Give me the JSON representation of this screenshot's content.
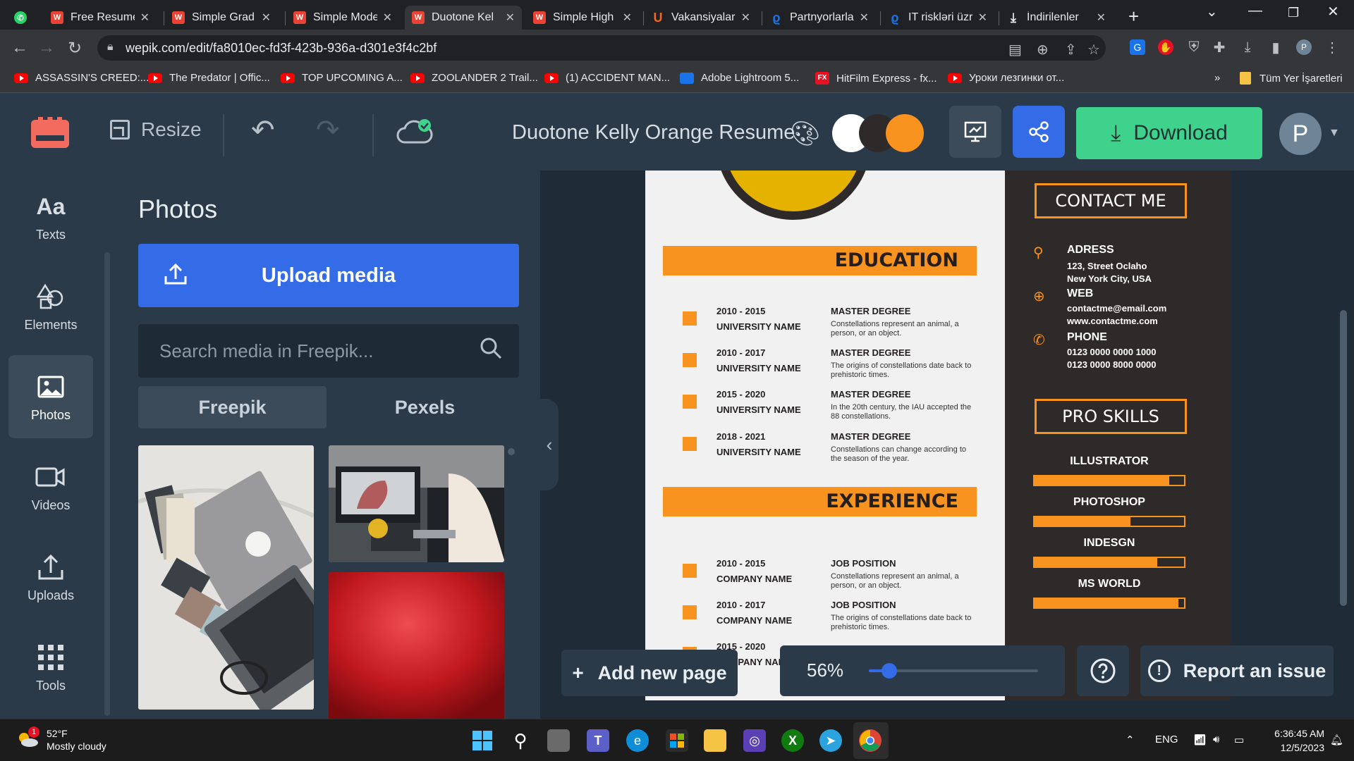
{
  "browser": {
    "tabs": [
      {
        "title": "Free Resume",
        "icon": "wepik-icon",
        "color": "#ea4335",
        "active": false
      },
      {
        "title": "Simple Grad",
        "icon": "wepik-icon",
        "color": "#ea4335",
        "active": false
      },
      {
        "title": "Simple Mode",
        "icon": "wepik-icon",
        "color": "#ea4335",
        "active": false
      },
      {
        "title": "Duotone Kel",
        "icon": "wepik-icon",
        "color": "#ea4335",
        "active": true
      },
      {
        "title": "Simple High",
        "icon": "wepik-icon",
        "color": "#ea4335",
        "active": false
      },
      {
        "title": "Vakansiyalar",
        "icon": "upwork-icon",
        "color": "#f26522",
        "active": false
      },
      {
        "title": "Partnyorlarla",
        "icon": "link-icon",
        "color": "#1a73e8",
        "active": false
      },
      {
        "title": "IT riskləri üzr",
        "icon": "link-icon",
        "color": "#1a73e8",
        "active": false
      },
      {
        "title": "İndirilenler",
        "icon": "download-icon",
        "color": "#e8eaed",
        "active": false
      }
    ],
    "url": "wepik.com/edit/fa8010ec-fd3f-423b-936a-d301e3f4c2bf",
    "bookmarks": [
      {
        "label": "ASSASSIN'S CREED:...",
        "icon": "youtube-icon"
      },
      {
        "label": "The Predator | Offic...",
        "icon": "youtube-icon"
      },
      {
        "label": "TOP UPCOMING A...",
        "icon": "youtube-icon"
      },
      {
        "label": "ZOOLANDER 2 Trail...",
        "icon": "youtube-icon"
      },
      {
        "label": "(1) ACCIDENT MAN...",
        "icon": "youtube-icon"
      },
      {
        "label": "Adobe Lightroom 5...",
        "icon": "lightroom-icon"
      },
      {
        "label": "HitFilm Express - fx...",
        "icon": "fx-icon"
      },
      {
        "label": "Уроки лезгинки от...",
        "icon": "youtube-icon"
      }
    ],
    "bookmarks_overflow": "»",
    "all_bookmarks": "Tüm Yer İşaretleri"
  },
  "header": {
    "resize_label": "Resize",
    "doc_title": "Duotone Kelly Orange Resume",
    "swatches": [
      "#ffffff",
      "#2e2a2a",
      "#f7931e"
    ],
    "download_label": "Download",
    "avatar_initial": "P",
    "colors": {
      "bar": "#2b3a48",
      "share": "#346be6",
      "download": "#3fd28d",
      "present": "#3b4b5a"
    }
  },
  "rail": [
    {
      "label": "Texts",
      "icon": "text-icon",
      "glyph": "Aa"
    },
    {
      "label": "Elements",
      "icon": "elements-icon",
      "glyph": "⬡"
    },
    {
      "label": "Photos",
      "icon": "photo-icon",
      "glyph": "▣"
    },
    {
      "label": "Videos",
      "icon": "video-icon",
      "glyph": "⏵"
    },
    {
      "label": "Uploads",
      "icon": "upload-icon",
      "glyph": "⇧"
    },
    {
      "label": "Tools",
      "icon": "grid-icon",
      "glyph": "⠿"
    }
  ],
  "panel": {
    "title": "Photos",
    "upload_label": "Upload media",
    "search_placeholder": "Search media in Freepik...",
    "tabs": [
      "Freepik",
      "Pexels"
    ]
  },
  "resume": {
    "education_title": "EDUCATION",
    "education": [
      {
        "years": "2010 - 2015",
        "org": "UNIVERSITY NAME",
        "position": "MASTER DEGREE",
        "desc": "Constellations represent an animal, a person, or an object."
      },
      {
        "years": "2010 - 2017",
        "org": "UNIVERSITY NAME",
        "position": "MASTER DEGREE",
        "desc": "The origins of constellations date back to prehistoric times."
      },
      {
        "years": "2015 - 2020",
        "org": "UNIVERSITY NAME",
        "position": "MASTER DEGREE",
        "desc": "In the 20th century, the IAU accepted the 88 constellations."
      },
      {
        "years": "2018 - 2021",
        "org": "UNIVERSITY NAME",
        "position": "MASTER DEGREE",
        "desc": "Constellations can change according to the season of the year."
      }
    ],
    "experience_title": "EXPERIENCE",
    "experience": [
      {
        "years": "2010 - 2015",
        "org": "COMPANY NAME",
        "position": "JOB POSITION",
        "desc": "Constellations represent an animal, a person, or an object."
      },
      {
        "years": "2010 - 2017",
        "org": "COMPANY NAME",
        "position": "JOB POSITION",
        "desc": "The origins of constellations date back to prehistoric times."
      },
      {
        "years": "2015 - 2020",
        "org": "COMPANY NAME",
        "position": "",
        "desc": ""
      }
    ],
    "contact_title": "CONTACT ME",
    "contact": {
      "address_label": "ADRESS",
      "address_1": "123, Street Oclaho",
      "address_2": "New York City, USA",
      "web_label": "WEB",
      "web_1": "contactme@email.com",
      "web_2": "www.contactme.com",
      "phone_label": "PHONE",
      "phone_1": "0123 0000 0000 1000",
      "phone_2": "0123 0000 8000 0000"
    },
    "skills_title": "PRO SKILLS",
    "skills": [
      {
        "name": "ILLUSTRATOR",
        "level": 0.9
      },
      {
        "name": "PHOTOSHOP",
        "level": 0.64
      },
      {
        "name": "INDESGN",
        "level": 0.82
      },
      {
        "name": "MS WORLD",
        "level": 0.96
      }
    ],
    "accent": "#f7931e"
  },
  "controls": {
    "add_page_label": "Add new page",
    "zoom_label": "56%",
    "zoom_level": 0.12,
    "report_label": "Report an issue"
  },
  "taskbar": {
    "weather_temp": "52°F",
    "weather_cond": "Mostly cloudy",
    "weather_badge": "1",
    "lang": "ENG",
    "time": "6:36:45 AM",
    "date": "12/5/2023"
  }
}
